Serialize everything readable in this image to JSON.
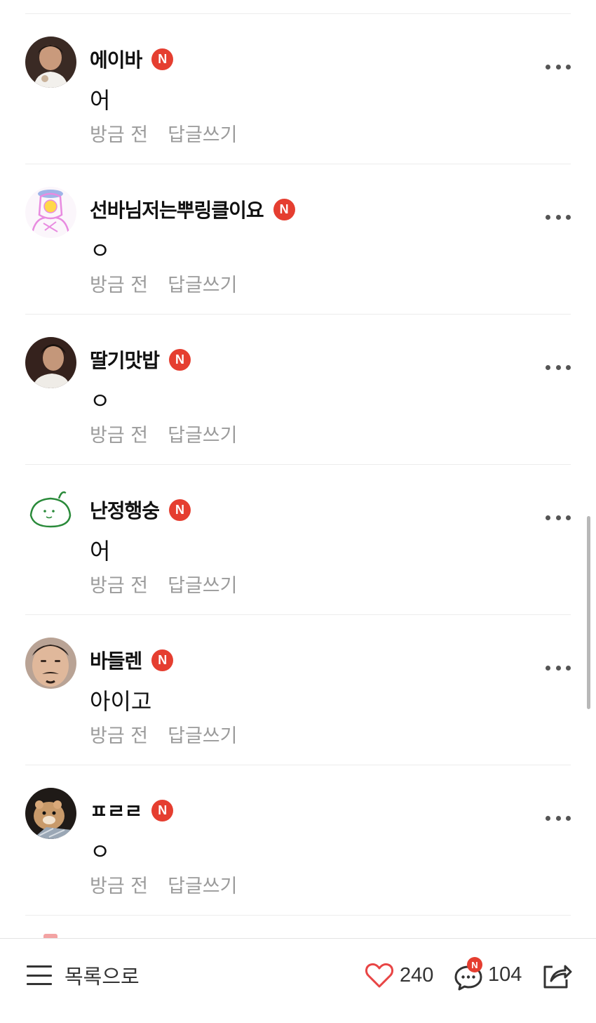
{
  "comments": [
    {
      "username": "에이바",
      "badge": "N",
      "text": "어",
      "time": "방금 전",
      "reply": "답글쓰기",
      "avatar": "dark-haired-person-avatar"
    },
    {
      "username": "선바님저는뿌링클이요",
      "badge": "N",
      "text": "ㅇ",
      "time": "방금 전",
      "reply": "답글쓰기",
      "avatar": "pink-drawing-avatar"
    },
    {
      "username": "딸기맛밥",
      "badge": "N",
      "text": "ㅇ",
      "time": "방금 전",
      "reply": "답글쓰기",
      "avatar": "dark-haired-person-avatar"
    },
    {
      "username": "난정행숭",
      "badge": "N",
      "text": "어",
      "time": "방금 전",
      "reply": "답글쓰기",
      "avatar": "green-doodle-avatar"
    },
    {
      "username": "바들렌",
      "badge": "N",
      "text": "아이고",
      "time": "방금 전",
      "reply": "답글쓰기",
      "avatar": "mustache-face-avatar"
    },
    {
      "username": "ㅍㄹㄹ",
      "badge": "N",
      "text": "ㅇ",
      "time": "방금 전",
      "reply": "답글쓰기",
      "avatar": "hamster-avatar"
    }
  ],
  "bottom_bar": {
    "list_label": "목록으로",
    "like_count": "240",
    "comment_count": "104",
    "comment_badge": "N"
  },
  "colors": {
    "badge_red": "#e53e30",
    "meta_gray": "#9b9b9b",
    "heart_red": "#e84545"
  }
}
